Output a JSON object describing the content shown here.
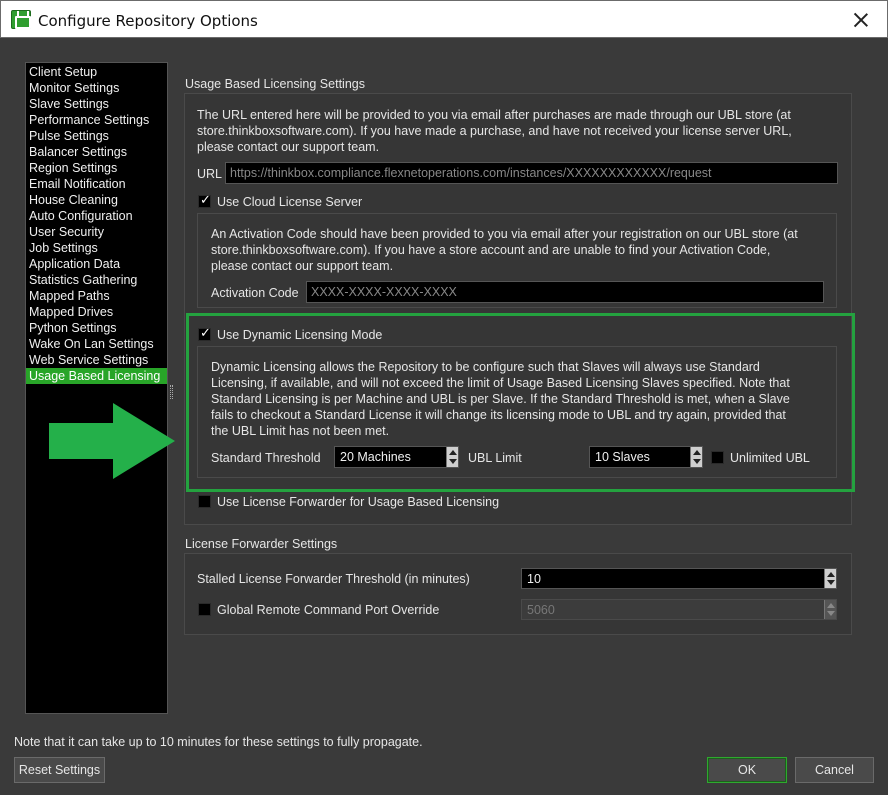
{
  "window": {
    "title": "Configure Repository Options"
  },
  "sidebar": {
    "items": [
      "Client Setup",
      "Monitor Settings",
      "Slave Settings",
      "Performance Settings",
      "Pulse Settings",
      "Balancer Settings",
      "Region Settings",
      "Email Notification",
      "House Cleaning",
      "Auto Configuration",
      "User Security",
      "Job Settings",
      "Application Data",
      "Statistics Gathering",
      "Mapped Paths",
      "Mapped Drives",
      "Python Settings",
      "Wake On Lan Settings",
      "Web Service Settings",
      "Usage Based Licensing"
    ],
    "selected_index": 19
  },
  "ubl": {
    "group_title": "Usage Based Licensing Settings",
    "intro_lines": [
      "The URL entered here will be provided to you via email after purchases are made through our UBL store (at",
      "store.thinkboxsoftware.com). If you have made a purchase, and have not received your license server URL,",
      "please contact our support team."
    ],
    "url_label": "URL",
    "url_value": "https://thinkbox.compliance.flexnetoperations.com/instances/XXXXXXXXXXXX/request",
    "cloud_checkbox_label": "Use Cloud License Server",
    "cloud_checked": true,
    "activation_lines": [
      "An Activation Code should have been provided to you via email after your registration on our UBL store (at",
      "store.thinkboxsoftware.com). If you have a store account and are unable to find your Activation Code,",
      "please contact our support team."
    ],
    "activation_label": "Activation Code",
    "activation_value": "XXXX-XXXX-XXXX-XXXX",
    "dynamic_checkbox_label": "Use Dynamic Licensing Mode",
    "dynamic_checked": true,
    "dynamic_lines": [
      "Dynamic Licensing allows the Repository to be configure such that Slaves will always use Standard",
      "Licensing, if available, and will not exceed the limit of Usage Based Licensing Slaves specified. Note that",
      "Standard Licensing is per Machine and UBL is per Slave. If the Standard Threshold is met, when a Slave",
      "fails to checkout a Standard License it will change its licensing mode to UBL and try again, provided that",
      "the UBL Limit has not been met."
    ],
    "standard_threshold_label": "Standard Threshold",
    "standard_threshold_value": "20 Machines",
    "ubl_limit_label": "UBL Limit",
    "ubl_limit_value": "10 Slaves",
    "unlimited_label": "Unlimited UBL",
    "unlimited_checked": false,
    "forwarder_checkbox_label": "Use License Forwarder for Usage Based Licensing",
    "forwarder_checked": false
  },
  "forwarder": {
    "group_title": "License Forwarder Settings",
    "stalled_label": "Stalled License Forwarder Threshold (in minutes)",
    "stalled_value": "10",
    "port_checkbox_label": "Global Remote Command Port Override",
    "port_checked": false,
    "port_value": "5060"
  },
  "footer": {
    "note": "Note that it can take up to 10 minutes for these settings to fully propagate.",
    "reset_label": "Reset Settings",
    "ok_label": "OK",
    "cancel_label": "Cancel"
  },
  "colors": {
    "accent": "#28a528",
    "highlight_box": "#24a23f",
    "arrow": "#24b04a"
  }
}
